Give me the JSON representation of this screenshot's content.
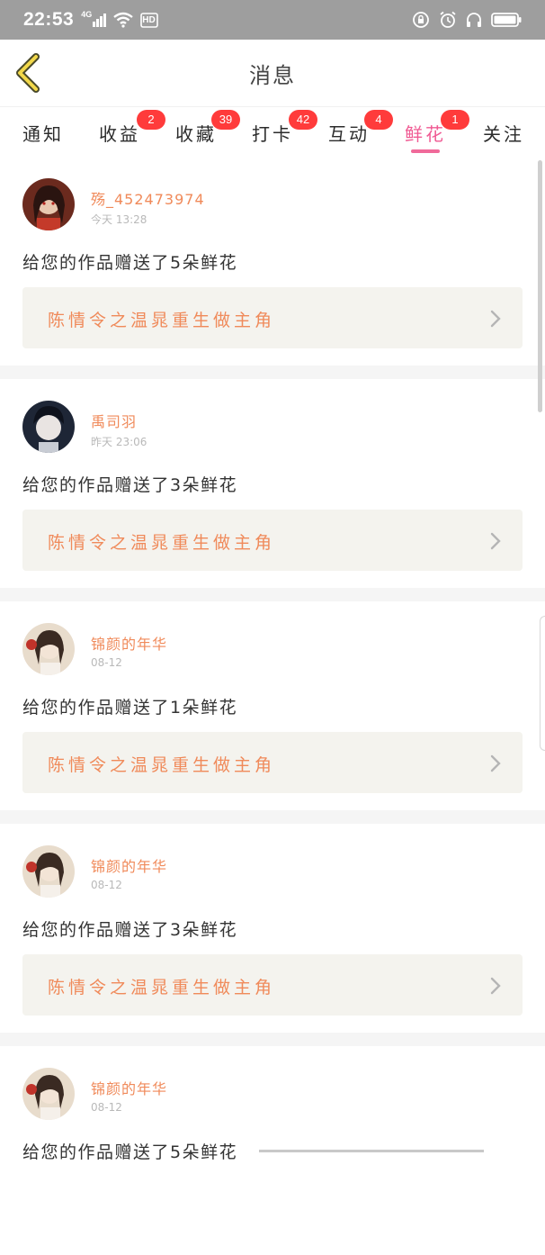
{
  "status_bar": {
    "time": "22:53",
    "network": "4G",
    "hd": "HD",
    "icons": [
      "signal-icon",
      "wifi-icon",
      "hd-icon",
      "lock-rotation-icon",
      "alarm-icon",
      "headphones-icon",
      "battery-icon"
    ]
  },
  "header": {
    "title": "消息",
    "back_icon": "chevron-left-icon"
  },
  "tabs": [
    {
      "label": "通知",
      "badge": ""
    },
    {
      "label": "收益",
      "badge": "2"
    },
    {
      "label": "收藏",
      "badge": "39"
    },
    {
      "label": "打卡",
      "badge": "42"
    },
    {
      "label": "互动",
      "badge": "4"
    },
    {
      "label": "鲜花",
      "badge": "1",
      "active": true
    },
    {
      "label": "关注",
      "badge": ""
    }
  ],
  "colors": {
    "accent": "#f05a93",
    "name": "#f08a5a",
    "badge": "#ff3b3b",
    "work_bg": "#f4f3ee"
  },
  "messages": [
    {
      "user": "殇_452473974",
      "time": "今天 13:28",
      "text": "给您的作品赠送了5朵鲜花",
      "work": "陈情令之温晁重生做主角"
    },
    {
      "user": "禹司羽",
      "time": "昨天 23:06",
      "text": "给您的作品赠送了3朵鲜花",
      "work": "陈情令之温晁重生做主角"
    },
    {
      "user": "锦颜的年华",
      "time": "08-12",
      "text": "给您的作品赠送了1朵鲜花",
      "work": "陈情令之温晁重生做主角"
    },
    {
      "user": "锦颜的年华",
      "time": "08-12",
      "text": "给您的作品赠送了3朵鲜花",
      "work": "陈情令之温晁重生做主角"
    },
    {
      "user": "锦颜的年华",
      "time": "08-12",
      "text": "给您的作品赠送了5朵鲜花",
      "work": ""
    }
  ]
}
